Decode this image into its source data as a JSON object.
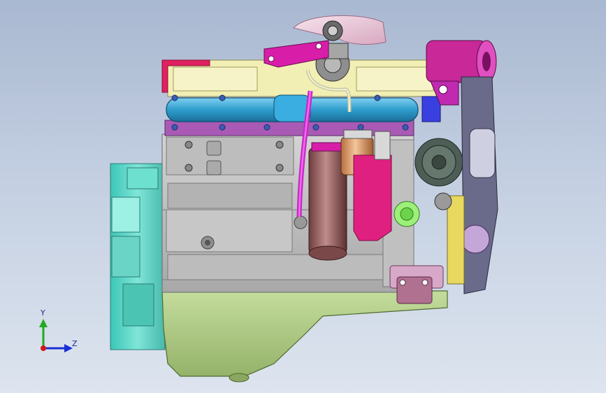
{
  "viewport": {
    "background_top": "#a9b8d1",
    "background_bottom": "#dde4ef"
  },
  "triad": {
    "y_label": "Y",
    "z_label": "Z",
    "y_color": "#22aa22",
    "z_color": "#1a2fd6",
    "origin_color": "#d01818"
  },
  "model": {
    "description_icon": "engine-assembly-icon",
    "colors": {
      "flywheel_housing": "#5fd8c8",
      "oil_pan": "#b8d48e",
      "block": "#c8c8c8",
      "exhaust_manifold": "#34a8d8",
      "valve_cover": "#f2efb4",
      "turbo": "#9a9a9a",
      "turbo_pipe": "#eac8d8",
      "magenta_parts": "#d81ea8",
      "oil_filter": "#a06a6a",
      "fuel_filter": "#e0a06a",
      "pump": "#e02080",
      "alternator": "#4e5e56",
      "compressor": "#c82898",
      "mount_bracket": "#b07090"
    }
  }
}
